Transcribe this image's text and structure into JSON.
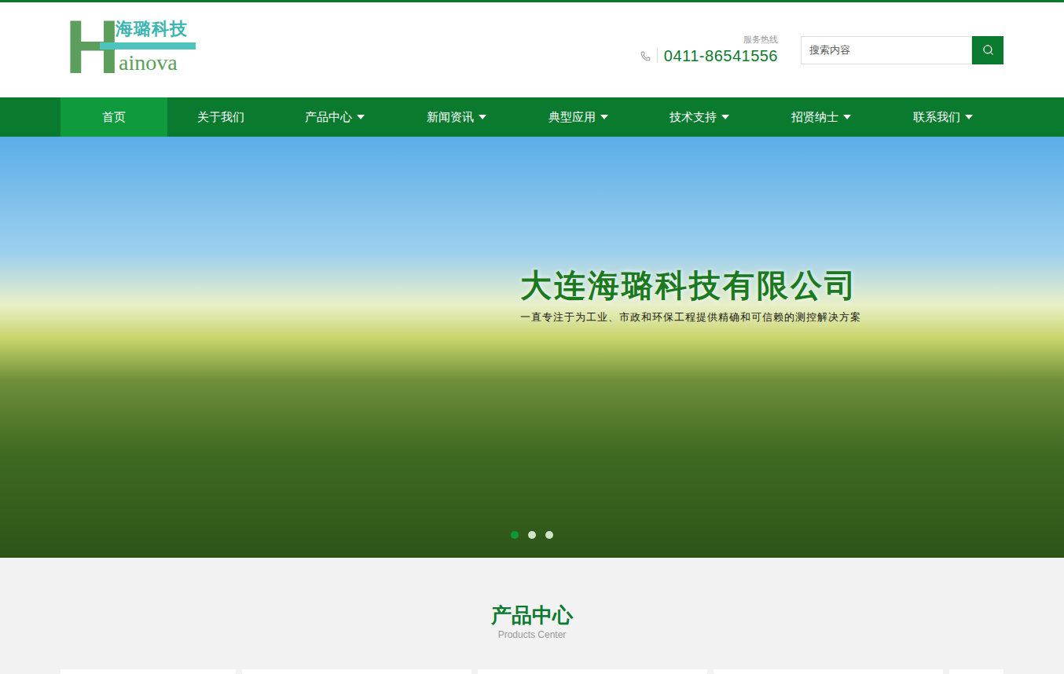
{
  "header": {
    "logo": {
      "letter": "H",
      "name": "海璐科技",
      "suffix": "ainova"
    },
    "hotline": {
      "label": "服务热线",
      "number": "0411-86541556"
    },
    "search": {
      "placeholder": "搜索内容"
    }
  },
  "nav": [
    {
      "label": "首页",
      "selected": true,
      "dropdown": false
    },
    {
      "label": "关于我们",
      "selected": false,
      "dropdown": false
    },
    {
      "label": "产品中心",
      "selected": false,
      "dropdown": true
    },
    {
      "label": "新闻资讯",
      "selected": false,
      "dropdown": true
    },
    {
      "label": "典型应用",
      "selected": false,
      "dropdown": true
    },
    {
      "label": "技术支持",
      "selected": false,
      "dropdown": true
    },
    {
      "label": "招贤纳士",
      "selected": false,
      "dropdown": true
    },
    {
      "label": "联系我们",
      "selected": false,
      "dropdown": true
    }
  ],
  "banner": {
    "title": "大连海璐科技有限公司",
    "subtitle": "一直专注于为工业、市政和环保工程提供精确和可信赖的测控解决方案",
    "dots": [
      {
        "selected": true
      },
      {
        "selected": false
      },
      {
        "selected": false
      }
    ]
  },
  "products": {
    "title": "产品中心",
    "subtitle": "Products Center"
  }
}
